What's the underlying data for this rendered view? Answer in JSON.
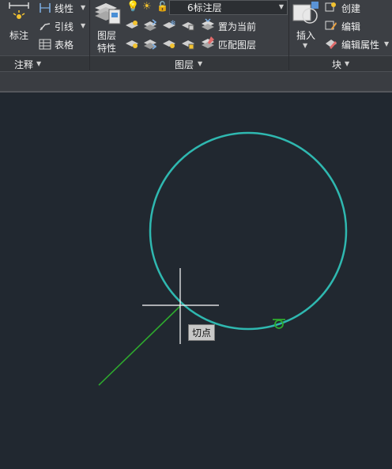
{
  "ribbon": {
    "annotation": {
      "dimension_label": "标注",
      "linear_label": "线性",
      "leader_label": "引线",
      "table_label": "表格",
      "panel_label": "注释"
    },
    "layers": {
      "layer_properties_label_line1": "图层",
      "layer_properties_label_line2": "特性",
      "current_layer_name": "6标注层",
      "current_layer_color": "#22cc22",
      "set_current_label": "置为当前",
      "match_layer_label": "匹配图层",
      "panel_label": "图层"
    },
    "block": {
      "insert_label": "插入",
      "create_label": "创建",
      "edit_label": "编辑",
      "edit_attributes_label": "编辑属性",
      "panel_label": "块"
    }
  },
  "canvas": {
    "background": "#212830",
    "circle_color": "#2fb8b0",
    "line_color": "#2eaa2e",
    "crosshair_color": "#ffffff",
    "snap_marker_color": "#2eaa2e",
    "snap_tooltip": "切点"
  }
}
